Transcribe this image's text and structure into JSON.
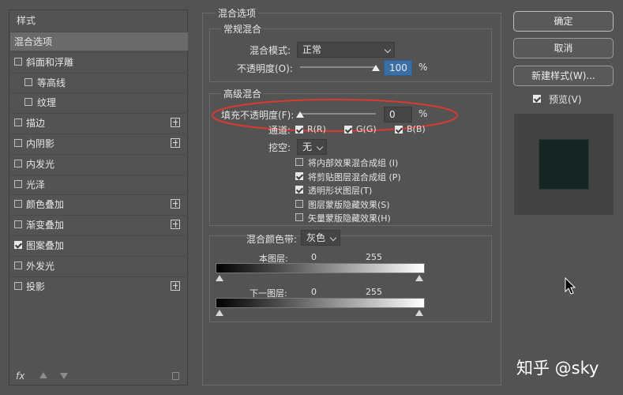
{
  "left_panel": {
    "header": "样式",
    "items": [
      {
        "label": "混合选项",
        "checkbox": false,
        "checked": false,
        "plus": false,
        "selected": true
      },
      {
        "label": "斜面和浮雕",
        "checkbox": true,
        "checked": false,
        "plus": false
      },
      {
        "label": "等高线",
        "checkbox": true,
        "checked": false,
        "plus": false,
        "indent": true
      },
      {
        "label": "纹理",
        "checkbox": true,
        "checked": false,
        "plus": false,
        "indent": true
      },
      {
        "label": "描边",
        "checkbox": true,
        "checked": false,
        "plus": true
      },
      {
        "label": "内阴影",
        "checkbox": true,
        "checked": false,
        "plus": true
      },
      {
        "label": "内发光",
        "checkbox": true,
        "checked": false,
        "plus": false
      },
      {
        "label": "光泽",
        "checkbox": true,
        "checked": false,
        "plus": false
      },
      {
        "label": "颜色叠加",
        "checkbox": true,
        "checked": false,
        "plus": true
      },
      {
        "label": "渐变叠加",
        "checkbox": true,
        "checked": false,
        "plus": true
      },
      {
        "label": "图案叠加",
        "checkbox": true,
        "checked": true,
        "plus": false
      },
      {
        "label": "外发光",
        "checkbox": true,
        "checked": false,
        "plus": false
      },
      {
        "label": "投影",
        "checkbox": true,
        "checked": false,
        "plus": true
      }
    ],
    "footer": {
      "fx": "fx",
      "fx_icon": "fx-icon",
      "up_icon": "move-up-icon",
      "down_icon": "move-down-icon",
      "trash_icon": "trash-icon"
    }
  },
  "blend": {
    "section_title": "混合选项",
    "general": {
      "title": "常规混合",
      "mode_label": "混合模式:",
      "mode_value": "正常",
      "opacity_label": "不透明度(O):",
      "opacity_value": "100",
      "opacity_unit": "%",
      "opacity_fraction": 1.0
    },
    "advanced": {
      "title": "高级混合",
      "fill_label": "填充不透明度(F):",
      "fill_value": "0",
      "fill_unit": "%",
      "fill_fraction": 0.0,
      "channels_label": "通道:",
      "channels": [
        {
          "label": "R(R)",
          "checked": true
        },
        {
          "label": "G(G)",
          "checked": true
        },
        {
          "label": "B(B)",
          "checked": true
        }
      ],
      "knockout_label": "挖空:",
      "knockout_value": "无",
      "options": [
        {
          "label": "将内部效果混合成组 (I)",
          "checked": false
        },
        {
          "label": "将剪贴图层混合成组 (P)",
          "checked": true
        },
        {
          "label": "透明形状图层(T)",
          "checked": true
        },
        {
          "label": "图层蒙版隐藏效果(S)",
          "checked": false
        },
        {
          "label": "矢量蒙版隐藏效果(H)",
          "checked": false
        }
      ]
    },
    "blend_if": {
      "label": "混合颜色带:",
      "value": "灰色",
      "this_layer_label": "本图层:",
      "this_layer_low": "0",
      "this_layer_high": "255",
      "under_layer_label": "下一图层:",
      "under_layer_low": "0",
      "under_layer_high": "255"
    },
    "highlight_color": "#d93a2f"
  },
  "buttons": {
    "ok": "确定",
    "cancel": "取消",
    "new_style": "新建样式(W)...",
    "preview_label": "预览(V)",
    "preview_checked": true
  },
  "watermark": "知乎 @sky",
  "cursor_icon": "mouse-pointer-icon"
}
